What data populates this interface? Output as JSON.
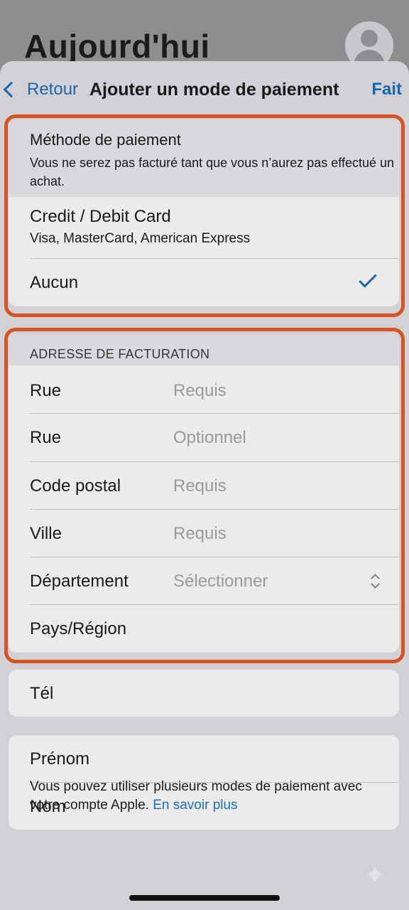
{
  "background": {
    "title": "Aujourd'hui"
  },
  "nav": {
    "back_label": "Retour",
    "title": "Ajouter un mode de paiement",
    "done_label": "Fait"
  },
  "payment": {
    "title": "Méthode de paiement",
    "description": "Vous ne serez pas facturé tant que vous n’aurez pas effectué un achat.",
    "card_label": "Credit / Debit Card",
    "card_sub": "Visa, MasterCard, American Express",
    "none_label": "Aucun",
    "selected": "Aucun"
  },
  "billing": {
    "header": "ADRESSE DE FACTURATION",
    "rows": [
      {
        "label": "Rue",
        "placeholder": "Requis"
      },
      {
        "label": "Rue",
        "placeholder": "Optionnel"
      },
      {
        "label": "Code postal",
        "placeholder": "Requis"
      },
      {
        "label": "Ville",
        "placeholder": "Requis"
      },
      {
        "label": "Département",
        "placeholder": "Sélectionner"
      },
      {
        "label": "Pays/Région",
        "placeholder": ""
      }
    ]
  },
  "phone": {
    "label": "Tél"
  },
  "name": {
    "first_label": "Prénom",
    "last_label": "Nom"
  },
  "footer": {
    "text": "Vous pouvez utiliser plusieurs modes de paiement avec votre compte Apple. ",
    "link": "En savoir plus"
  },
  "colors": {
    "accent": "#1d6fb8",
    "highlight": "#ea5b25"
  }
}
